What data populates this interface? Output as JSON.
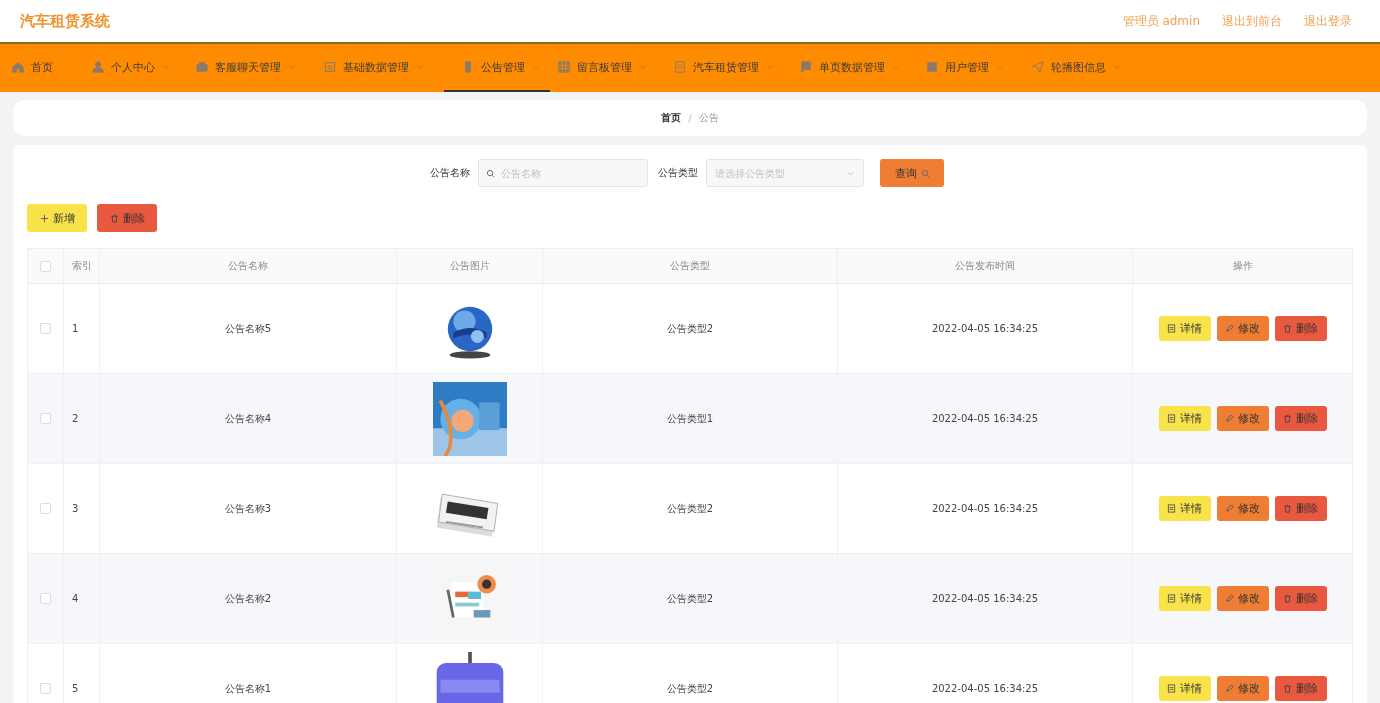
{
  "header": {
    "title": "汽车租赁系统",
    "links": [
      "管理员 admin",
      "退出到前台",
      "退出登录"
    ]
  },
  "nav": [
    {
      "label": "首页",
      "dropdown": false,
      "selected": false
    },
    {
      "label": "个人中心",
      "dropdown": true,
      "selected": false
    },
    {
      "label": "客服聊天管理",
      "dropdown": true,
      "selected": false
    },
    {
      "label": "基础数据管理",
      "dropdown": true,
      "selected": false
    },
    {
      "label": "公告管理",
      "dropdown": true,
      "selected": true
    },
    {
      "label": "留言板管理",
      "dropdown": true,
      "selected": false
    },
    {
      "label": "汽车租赁管理",
      "dropdown": true,
      "selected": false
    },
    {
      "label": "单页数据管理",
      "dropdown": true,
      "selected": false
    },
    {
      "label": "用户管理",
      "dropdown": true,
      "selected": false
    },
    {
      "label": "轮播图信息",
      "dropdown": true,
      "selected": false
    }
  ],
  "breadcrumb": {
    "items": [
      "首页",
      "公告"
    ],
    "separator": "/"
  },
  "search": {
    "fields": [
      {
        "kind": "text",
        "label": "公告名称",
        "placeholder": "公告名称"
      },
      {
        "kind": "select",
        "label": "公告类型",
        "placeholder": "请选择公告类型"
      }
    ],
    "button": "查询"
  },
  "actions": [
    {
      "kind": "add",
      "label": "新增"
    },
    {
      "kind": "delete",
      "label": "删除"
    }
  ],
  "table": {
    "columns": [
      "索引",
      "公告名称",
      "公告图片",
      "公告类型",
      "公告发布时间",
      "操作"
    ],
    "header_checked": false,
    "rows": [
      {
        "selected": false,
        "index": "1",
        "name": "公告名称5",
        "type": "公告类型2",
        "time": "2022-04-05 16:34:25",
        "actions": [
          "详情",
          "修改",
          "删除"
        ]
      },
      {
        "selected": false,
        "index": "2",
        "name": "公告名称4",
        "type": "公告类型1",
        "time": "2022-04-05 16:34:25",
        "actions": [
          "详情",
          "修改",
          "删除"
        ]
      },
      {
        "selected": false,
        "index": "3",
        "name": "公告名称3",
        "type": "公告类型2",
        "time": "2022-04-05 16:34:25",
        "actions": [
          "详情",
          "修改",
          "删除"
        ]
      },
      {
        "selected": false,
        "index": "4",
        "name": "公告名称2",
        "type": "公告类型2",
        "time": "2022-04-05 16:34:25",
        "actions": [
          "详情",
          "修改",
          "删除"
        ]
      },
      {
        "selected": false,
        "index": "5",
        "name": "公告名称1",
        "type": "公告类型2",
        "time": "2022-04-05 16:34:25",
        "actions": [
          "详情",
          "修改",
          "删除"
        ]
      }
    ]
  }
}
